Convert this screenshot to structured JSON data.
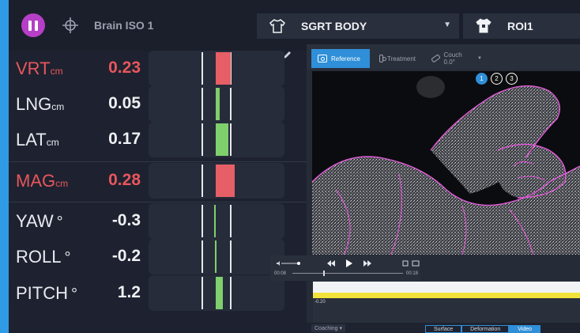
{
  "topbar": {
    "setup_name": "Brain ISO 1",
    "body_selector": "SGRT BODY",
    "roi_name": "ROI1"
  },
  "metrics": [
    {
      "name": "VRT",
      "unit": "cm",
      "value": "0.23",
      "alert": true,
      "bar_from": 0.496,
      "bar_to": 0.605,
      "color": "#e65f67"
    },
    {
      "name": "LNG",
      "unit": "cm",
      "value": "0.05",
      "alert": false,
      "bar_from": 0.496,
      "bar_to": 0.526,
      "color": "#7fcf6d"
    },
    {
      "name": "LAT",
      "unit": "cm",
      "value": "0.17",
      "alert": false,
      "bar_from": 0.496,
      "bar_to": 0.585,
      "color": "#7fcf6d"
    },
    {
      "name": "MAG",
      "unit": "cm",
      "value": "0.28",
      "alert": true,
      "bar_from": 0.496,
      "bar_to": 0.635,
      "color": "#e65f67"
    },
    {
      "name": "YAW",
      "unit": "°",
      "value": "-0.3",
      "alert": false,
      "bar_from": 0.485,
      "bar_to": 0.496,
      "color": "#7fcf6d"
    },
    {
      "name": "ROLL",
      "unit": "°",
      "value": "-0.2",
      "alert": false,
      "bar_from": 0.488,
      "bar_to": 0.496,
      "color": "#7fcf6d"
    },
    {
      "name": "PITCH",
      "unit": "°",
      "value": "1.2",
      "alert": false,
      "bar_from": 0.496,
      "bar_to": 0.545,
      "color": "#7fcf6d"
    }
  ],
  "viewer": {
    "tabs": [
      "Reference",
      "Treatment",
      "Couch 0.0°"
    ],
    "badges": [
      "1",
      "2",
      "3"
    ]
  },
  "player": {
    "start_time": "00:08",
    "end_time": "00:18",
    "progress": 0.28
  },
  "timeline": {
    "scale_label": "-0.20"
  },
  "bottom": {
    "coaching": "Coaching",
    "tabs": [
      "Surface",
      "Deformation",
      "Video"
    ]
  },
  "colors": {
    "accent": "#2f9be6",
    "alert": "#e8565c",
    "ok": "#7fcf6d",
    "pause": "#b63fc8",
    "overlay": "#e05ad6"
  }
}
